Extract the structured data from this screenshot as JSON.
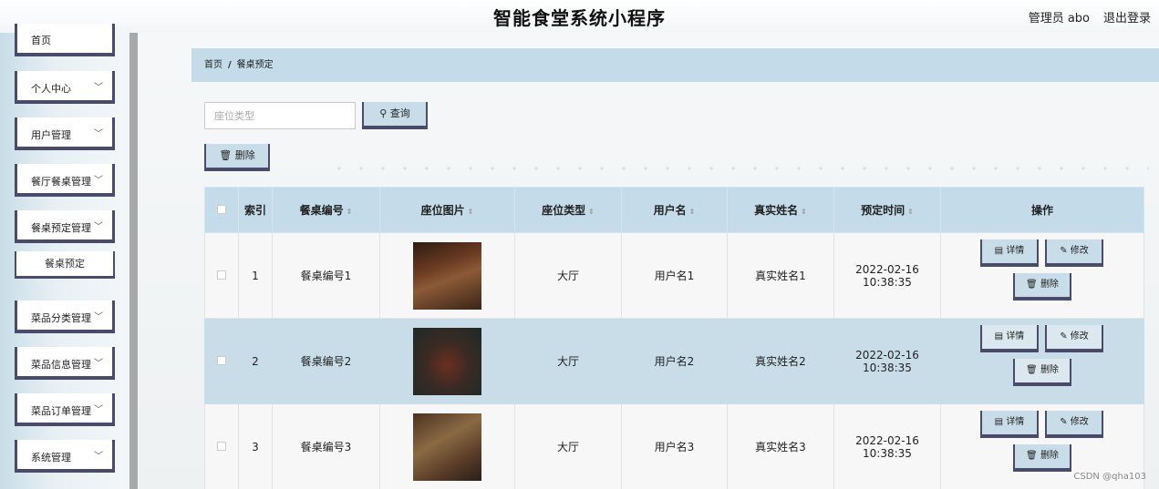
{
  "header": {
    "title": "智能食堂系统小程序",
    "admin": "管理员 abo",
    "logout": "退出登录"
  },
  "sidebar": {
    "items": [
      {
        "label": "首页"
      },
      {
        "label": "个人中心"
      },
      {
        "label": "用户管理"
      },
      {
        "label": "餐厅餐桌管理"
      },
      {
        "label": "餐桌预定管理"
      },
      {
        "label": "菜品分类管理"
      },
      {
        "label": "菜品信息管理"
      },
      {
        "label": "菜品订单管理"
      },
      {
        "label": "系统管理"
      }
    ],
    "submenu": "餐桌预定",
    "chevron": "chevron-down-icon"
  },
  "breadcrumb": {
    "home": "首页",
    "separator": "/",
    "current": "餐桌预定"
  },
  "search": {
    "placeholder": "座位类型",
    "button": "查询",
    "icon": "search-icon"
  },
  "toolbar": {
    "delete": "删除",
    "icon": "trash-icon"
  },
  "table": {
    "headers": [
      "索引",
      "餐桌编号",
      "座位图片",
      "座位类型",
      "用户名",
      "真实姓名",
      "预定时间",
      "操作"
    ],
    "rows": [
      {
        "index": "1",
        "table_no": "餐桌编号1",
        "seat_type": "大厅",
        "username": "用户名1",
        "real_name": "真实姓名1",
        "time": "2022-02-16 10:38:35"
      },
      {
        "index": "2",
        "table_no": "餐桌编号2",
        "seat_type": "大厅",
        "username": "用户名2",
        "real_name": "真实姓名2",
        "time": "2022-02-16 10:38:35"
      },
      {
        "index": "3",
        "table_no": "餐桌编号3",
        "seat_type": "大厅",
        "username": "用户名3",
        "real_name": "真实姓名3",
        "time": "2022-02-16 10:38:35"
      }
    ],
    "actions": {
      "detail": "详情",
      "edit": "修改",
      "delete": "删除"
    }
  },
  "watermark": "CSDN @qha103",
  "colors": {
    "accent": "#c4dcea",
    "border": "#4a4a6a"
  }
}
